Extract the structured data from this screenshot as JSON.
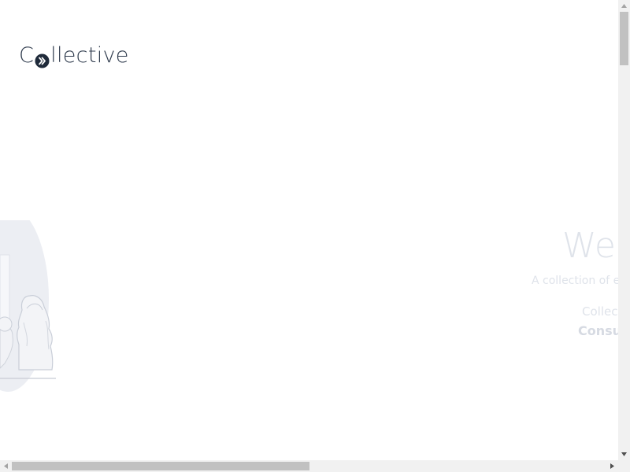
{
  "logo": {
    "first_letter": "C",
    "rest": "llective",
    "icon": "chevron-right-double-icon",
    "text_color": "#2e3a4c"
  },
  "hero": {
    "title": "We",
    "subtitle": "A collection of e",
    "line1": "Collec",
    "line2": "Consu"
  },
  "illustration": {
    "icon": "people-illustration",
    "color": "#e4e7ee"
  },
  "scrollbars": {
    "vertical": {
      "up_icon": "arrow-up-icon",
      "down_icon": "arrow-down-icon"
    },
    "horizontal": {
      "left_icon": "arrow-left-icon",
      "right_icon": "arrow-right-icon"
    }
  }
}
